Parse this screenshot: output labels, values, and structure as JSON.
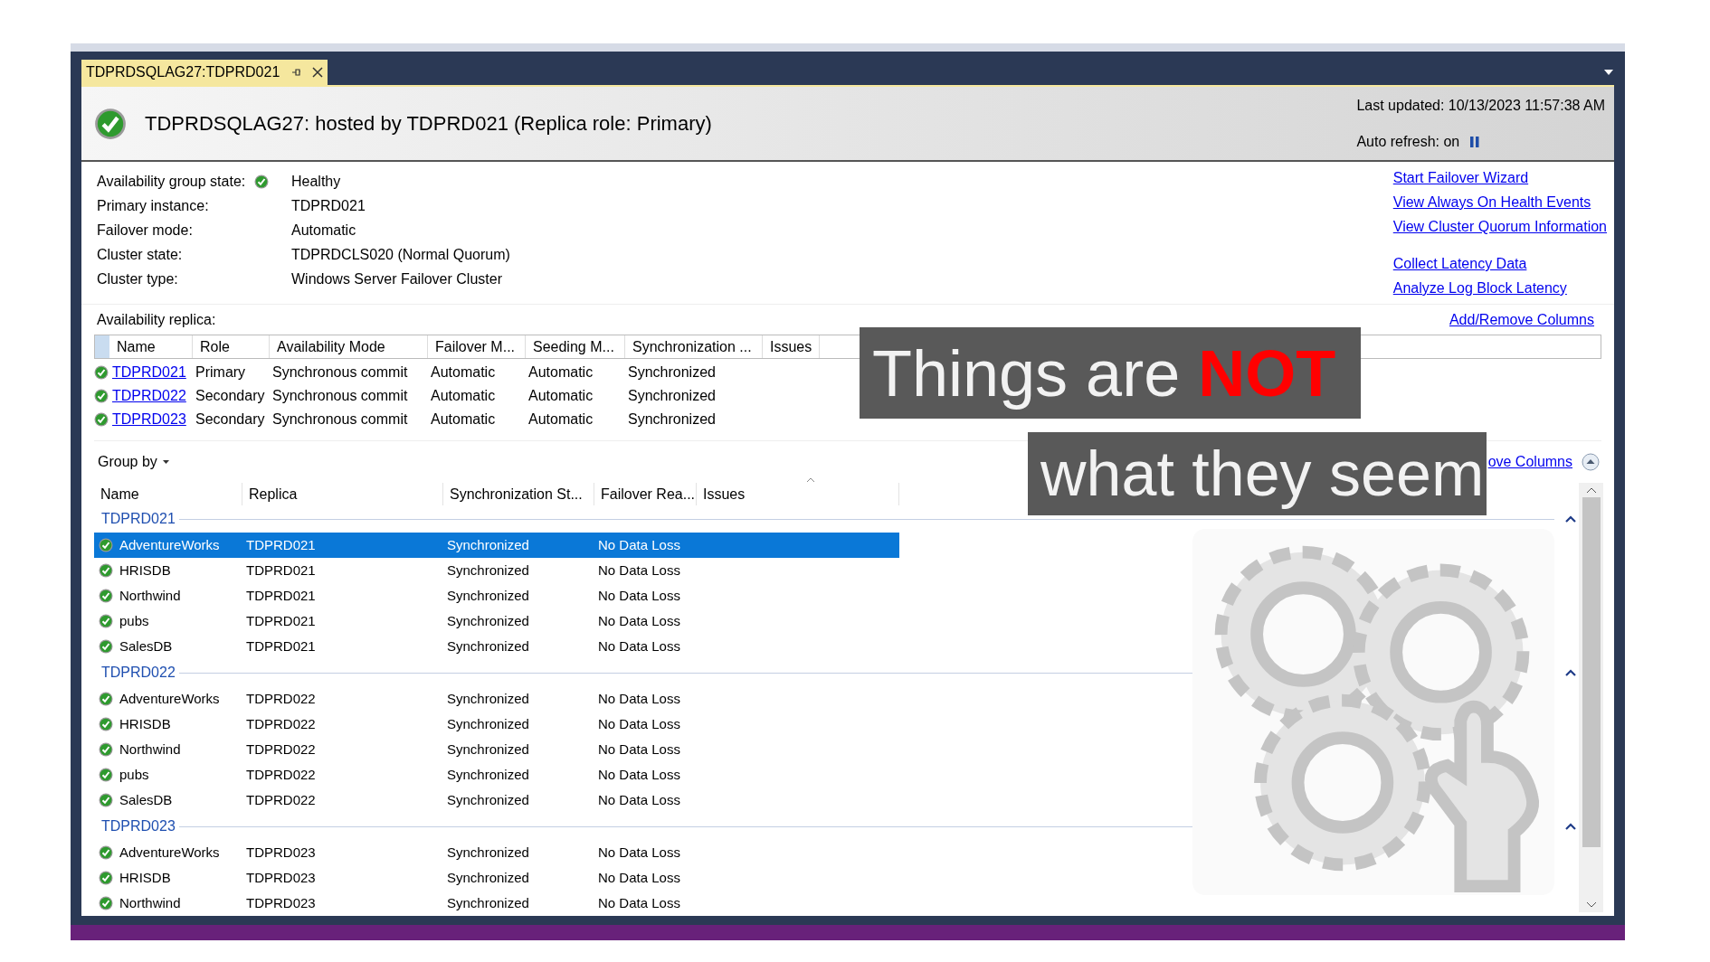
{
  "window": {
    "tab": {
      "title": "TDPRDSQLAG27:TDPRD021",
      "selected": true
    }
  },
  "header": {
    "healthy": true,
    "title": "TDPRDSQLAG27: hosted by TDPRD021 (Replica role: Primary)",
    "last_updated": "Last updated: 10/13/2023 11:57:38 AM",
    "auto_refresh": "Auto refresh: on"
  },
  "details": [
    {
      "label": "Availability group state:",
      "value": "Healthy",
      "kind": "status"
    },
    {
      "label": "Primary instance:",
      "value": "TDPRD021",
      "kind": "text"
    },
    {
      "label": "Failover mode:",
      "value": "Automatic",
      "kind": "text"
    },
    {
      "label": "Cluster state:",
      "value": "TDPRDCLS020 (Normal Quorum)",
      "kind": "text"
    },
    {
      "label": "Cluster type:",
      "value": "Windows Server Failover Cluster",
      "kind": "text"
    }
  ],
  "action_groups": [
    [
      "Start Failover Wizard",
      "View Always On Health Events",
      "View Cluster Quorum Information"
    ],
    [
      "Collect Latency Data",
      "Analyze Log Block Latency"
    ]
  ],
  "replica_section": {
    "label": "Availability replica:",
    "add_remove": "Add/Remove Columns",
    "columns": [
      "Name",
      "Role",
      "Availability Mode",
      "Failover M...",
      "Seeding M...",
      "Synchronization ...",
      "Issues"
    ],
    "rows": [
      {
        "healthy": true,
        "cells": [
          "TDPRD021",
          "Primary",
          "Synchronous commit",
          "Automatic",
          "Automatic",
          "Synchronized"
        ]
      },
      {
        "healthy": true,
        "cells": [
          "TDPRD022",
          "Secondary",
          "Synchronous commit",
          "Automatic",
          "Automatic",
          "Synchronized"
        ]
      },
      {
        "healthy": true,
        "cells": [
          "TDPRD023",
          "Secondary",
          "Synchronous commit",
          "Automatic",
          "Automatic",
          "Synchronized"
        ]
      }
    ]
  },
  "database_section": {
    "group_by": "Group by",
    "add_remove_partial": "ove Columns",
    "columns": [
      "Name",
      "Replica",
      "Synchronization St...",
      "Failover Rea...",
      "Issues"
    ],
    "groups": [
      {
        "name": "TDPRD021",
        "expanded": true,
        "rows": [
          {
            "healthy": true,
            "selected": true,
            "cells": [
              "AdventureWorks",
              "TDPRD021",
              "Synchronized",
              "No Data Loss"
            ]
          },
          {
            "healthy": true,
            "selected": false,
            "cells": [
              "HRISDB",
              "TDPRD021",
              "Synchronized",
              "No Data Loss"
            ]
          },
          {
            "healthy": true,
            "selected": false,
            "cells": [
              "Northwind",
              "TDPRD021",
              "Synchronized",
              "No Data Loss"
            ]
          },
          {
            "healthy": true,
            "selected": false,
            "cells": [
              "pubs",
              "TDPRD021",
              "Synchronized",
              "No Data Loss"
            ]
          },
          {
            "healthy": true,
            "selected": false,
            "cells": [
              "SalesDB",
              "TDPRD021",
              "Synchronized",
              "No Data Loss"
            ]
          }
        ]
      },
      {
        "name": "TDPRD022",
        "expanded": true,
        "rows": [
          {
            "healthy": true,
            "selected": false,
            "cells": [
              "AdventureWorks",
              "TDPRD022",
              "Synchronized",
              "No Data Loss"
            ]
          },
          {
            "healthy": true,
            "selected": false,
            "cells": [
              "HRISDB",
              "TDPRD022",
              "Synchronized",
              "No Data Loss"
            ]
          },
          {
            "healthy": true,
            "selected": false,
            "cells": [
              "Northwind",
              "TDPRD022",
              "Synchronized",
              "No Data Loss"
            ]
          },
          {
            "healthy": true,
            "selected": false,
            "cells": [
              "pubs",
              "TDPRD022",
              "Synchronized",
              "No Data Loss"
            ]
          },
          {
            "healthy": true,
            "selected": false,
            "cells": [
              "SalesDB",
              "TDPRD022",
              "Synchronized",
              "No Data Loss"
            ]
          }
        ]
      },
      {
        "name": "TDPRD023",
        "expanded": true,
        "rows": [
          {
            "healthy": true,
            "selected": false,
            "cells": [
              "AdventureWorks",
              "TDPRD023",
              "Synchronized",
              "No Data Loss"
            ]
          },
          {
            "healthy": true,
            "selected": false,
            "cells": [
              "HRISDB",
              "TDPRD023",
              "Synchronized",
              "No Data Loss"
            ]
          },
          {
            "healthy": true,
            "selected": false,
            "cells": [
              "Northwind",
              "TDPRD023",
              "Synchronized",
              "No Data Loss"
            ]
          }
        ]
      }
    ]
  },
  "overlay": {
    "line1": "Things are",
    "emphasis": "NOT",
    "line2": "what they seem"
  }
}
